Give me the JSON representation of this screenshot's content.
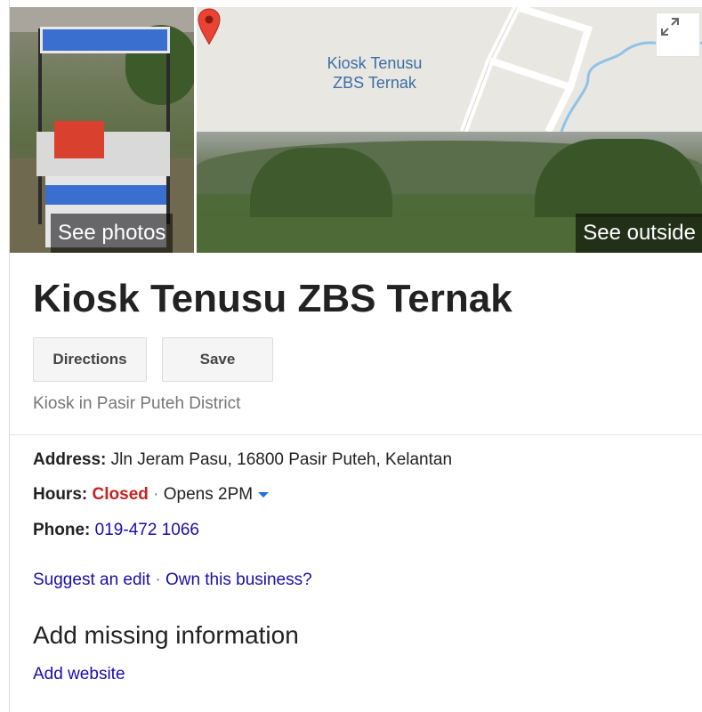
{
  "media": {
    "see_photos_label": "See photos",
    "see_outside_label": "See outside",
    "map_label_line1": "Kiosk Tenusu",
    "map_label_line2": "ZBS Ternak"
  },
  "place": {
    "title": "Kiosk Tenusu ZBS Ternak",
    "category": "Kiosk in Pasir Puteh District"
  },
  "actions": {
    "directions_label": "Directions",
    "save_label": "Save"
  },
  "details": {
    "address_label": "Address:",
    "address_value": "Jln Jeram Pasu, 16800 Pasir Puteh, Kelantan",
    "hours_label": "Hours:",
    "hours_status": "Closed",
    "hours_separator": "·",
    "hours_next": "Opens 2PM",
    "phone_label": "Phone:",
    "phone_value": "019-472 1066"
  },
  "links": {
    "suggest_edit": "Suggest an edit",
    "separator": "·",
    "own_business": "Own this business?"
  },
  "missing": {
    "heading": "Add missing information",
    "add_website": "Add website"
  },
  "colors": {
    "link": "#1a0dab",
    "closed": "#c5221f",
    "map_label": "#3b6ea5",
    "pin": "#ea4335"
  }
}
